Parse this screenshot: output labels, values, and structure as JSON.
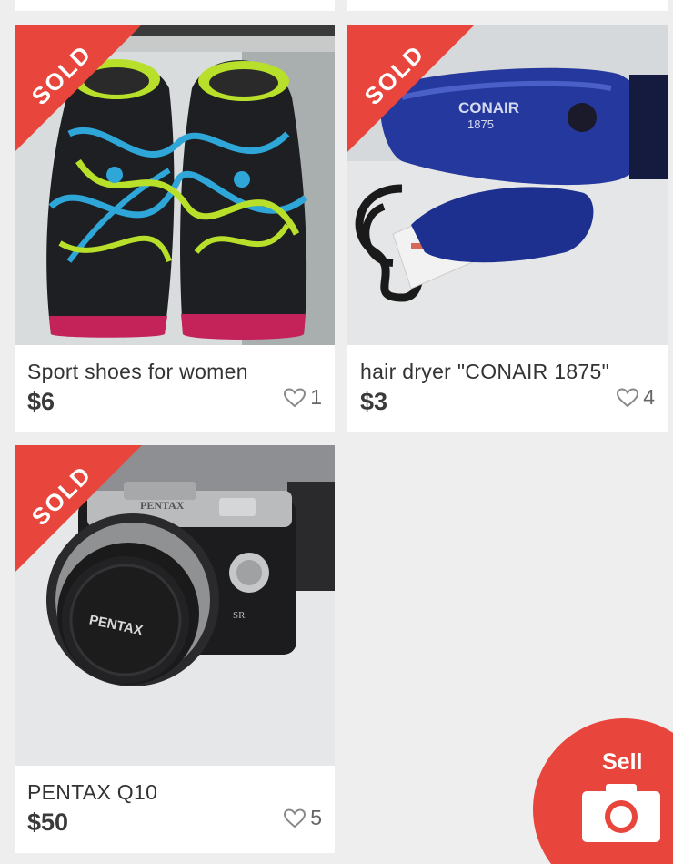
{
  "theme": {
    "accent": "#e8453c",
    "background": "#eeeeee",
    "card": "#ffffff"
  },
  "listings": [
    {
      "title": "Sport shoes for women",
      "price": "$6",
      "likes": "1",
      "status": "SOLD",
      "image": "sport-shoes-photo"
    },
    {
      "title": "hair dryer \"CONAIR 1875\"",
      "price": "$3",
      "likes": "4",
      "status": "SOLD",
      "image": "hair-dryer-photo",
      "image_text": [
        "CONAIR",
        "1875"
      ]
    },
    {
      "title": "PENTAX Q10",
      "price": "$50",
      "likes": "5",
      "status": "SOLD",
      "image": "camera-photo",
      "image_text": [
        "PENTAX",
        "PENTAX",
        "SR"
      ]
    }
  ],
  "sell_button": {
    "label": "Sell",
    "icon": "camera-icon"
  }
}
